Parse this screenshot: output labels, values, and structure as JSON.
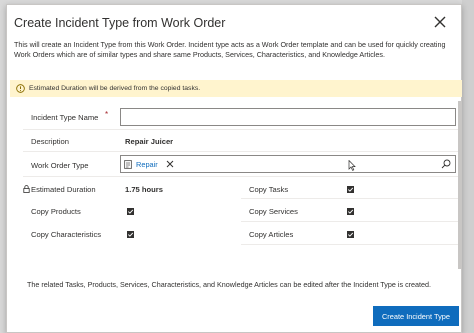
{
  "dialog": {
    "title": "Create Incident Type from Work Order",
    "description": "This will create an Incident Type from this Work Order. Incident type acts as a Work Order template and can be used for quickly creating Work Orders which are of similar types and share same Products, Services, Characteristics, and Knowledge Articles.",
    "banner_text": "Estimated Duration will be derived from the copied tasks.",
    "footer_text": "The related Tasks, Products, Services, Characteristics, and Knowledge Articles can be edited after the Incident Type is created.",
    "primary_button": "Create Incident Type"
  },
  "form": {
    "incident_type_name": {
      "label": "Incident Type Name",
      "required_marker": "*",
      "value": ""
    },
    "description": {
      "label": "Description",
      "value": "Repair Juicer"
    },
    "work_order_type": {
      "label": "Work Order Type",
      "tag": "Repair"
    },
    "estimated_duration": {
      "label": "Estimated Duration",
      "value": "1.75 hours"
    },
    "copy_tasks": {
      "label": "Copy Tasks",
      "checked": true
    },
    "copy_products": {
      "label": "Copy Products",
      "checked": true
    },
    "copy_services": {
      "label": "Copy Services",
      "checked": true
    },
    "copy_characteristics": {
      "label": "Copy Characteristics",
      "checked": true
    },
    "copy_articles": {
      "label": "Copy Articles",
      "checked": true
    }
  },
  "icons": {
    "close": "close-icon",
    "warning": "warning-icon",
    "lock": "lock-icon",
    "entity": "entity-record-icon",
    "remove": "remove-tag-icon",
    "search": "search-icon",
    "checkbox": "checkmark-icon"
  },
  "colors": {
    "accent": "#0f6cbd",
    "banner_bg": "#fff4ce",
    "required": "#a4262c"
  }
}
